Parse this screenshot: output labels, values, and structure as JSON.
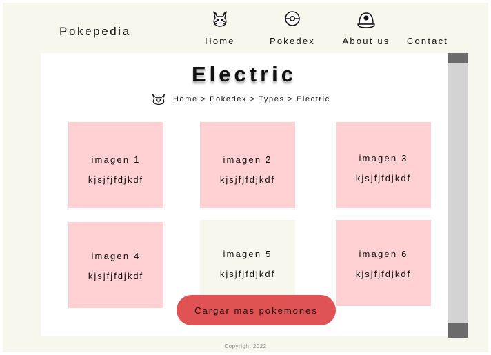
{
  "header": {
    "brand": "Pokepedia",
    "nav": [
      {
        "label": "Home",
        "icon": "pikachu-icon"
      },
      {
        "label": "Pokedex",
        "icon": "pokeball-icon"
      },
      {
        "label": "About us",
        "icon": "trainer-cap-icon"
      },
      {
        "label": "Contact"
      }
    ]
  },
  "main": {
    "title": "Electric",
    "breadcrumb": "Home > Pokedex > Types > Electric",
    "cards": [
      {
        "title": "imagen 1",
        "text": "kjsjfjfdjkdf"
      },
      {
        "title": "imagen 2",
        "text": "kjsjfjfdjkdf"
      },
      {
        "title": "imagen 3",
        "text": "kjsjfjfdjkdf"
      },
      {
        "title": "imagen 4",
        "text": "kjsjfjfdjkdf"
      },
      {
        "title": "imagen 5",
        "text": "kjsjfjfdjkdf"
      },
      {
        "title": "imagen 6",
        "text": "kjsjfjfdjkdf"
      }
    ],
    "load_more_label": "Cargar mas pokemones"
  },
  "footer": {
    "copyright": "Copyright 2022"
  },
  "colors": {
    "page_background": "#f7f7ee",
    "content_background": "#ffffff",
    "card_pink": "#ffd1d3",
    "button_red": "#e05355",
    "scrollbar_track": "#d3d3d3",
    "scrollbar_thumb": "#6b6b6b"
  }
}
